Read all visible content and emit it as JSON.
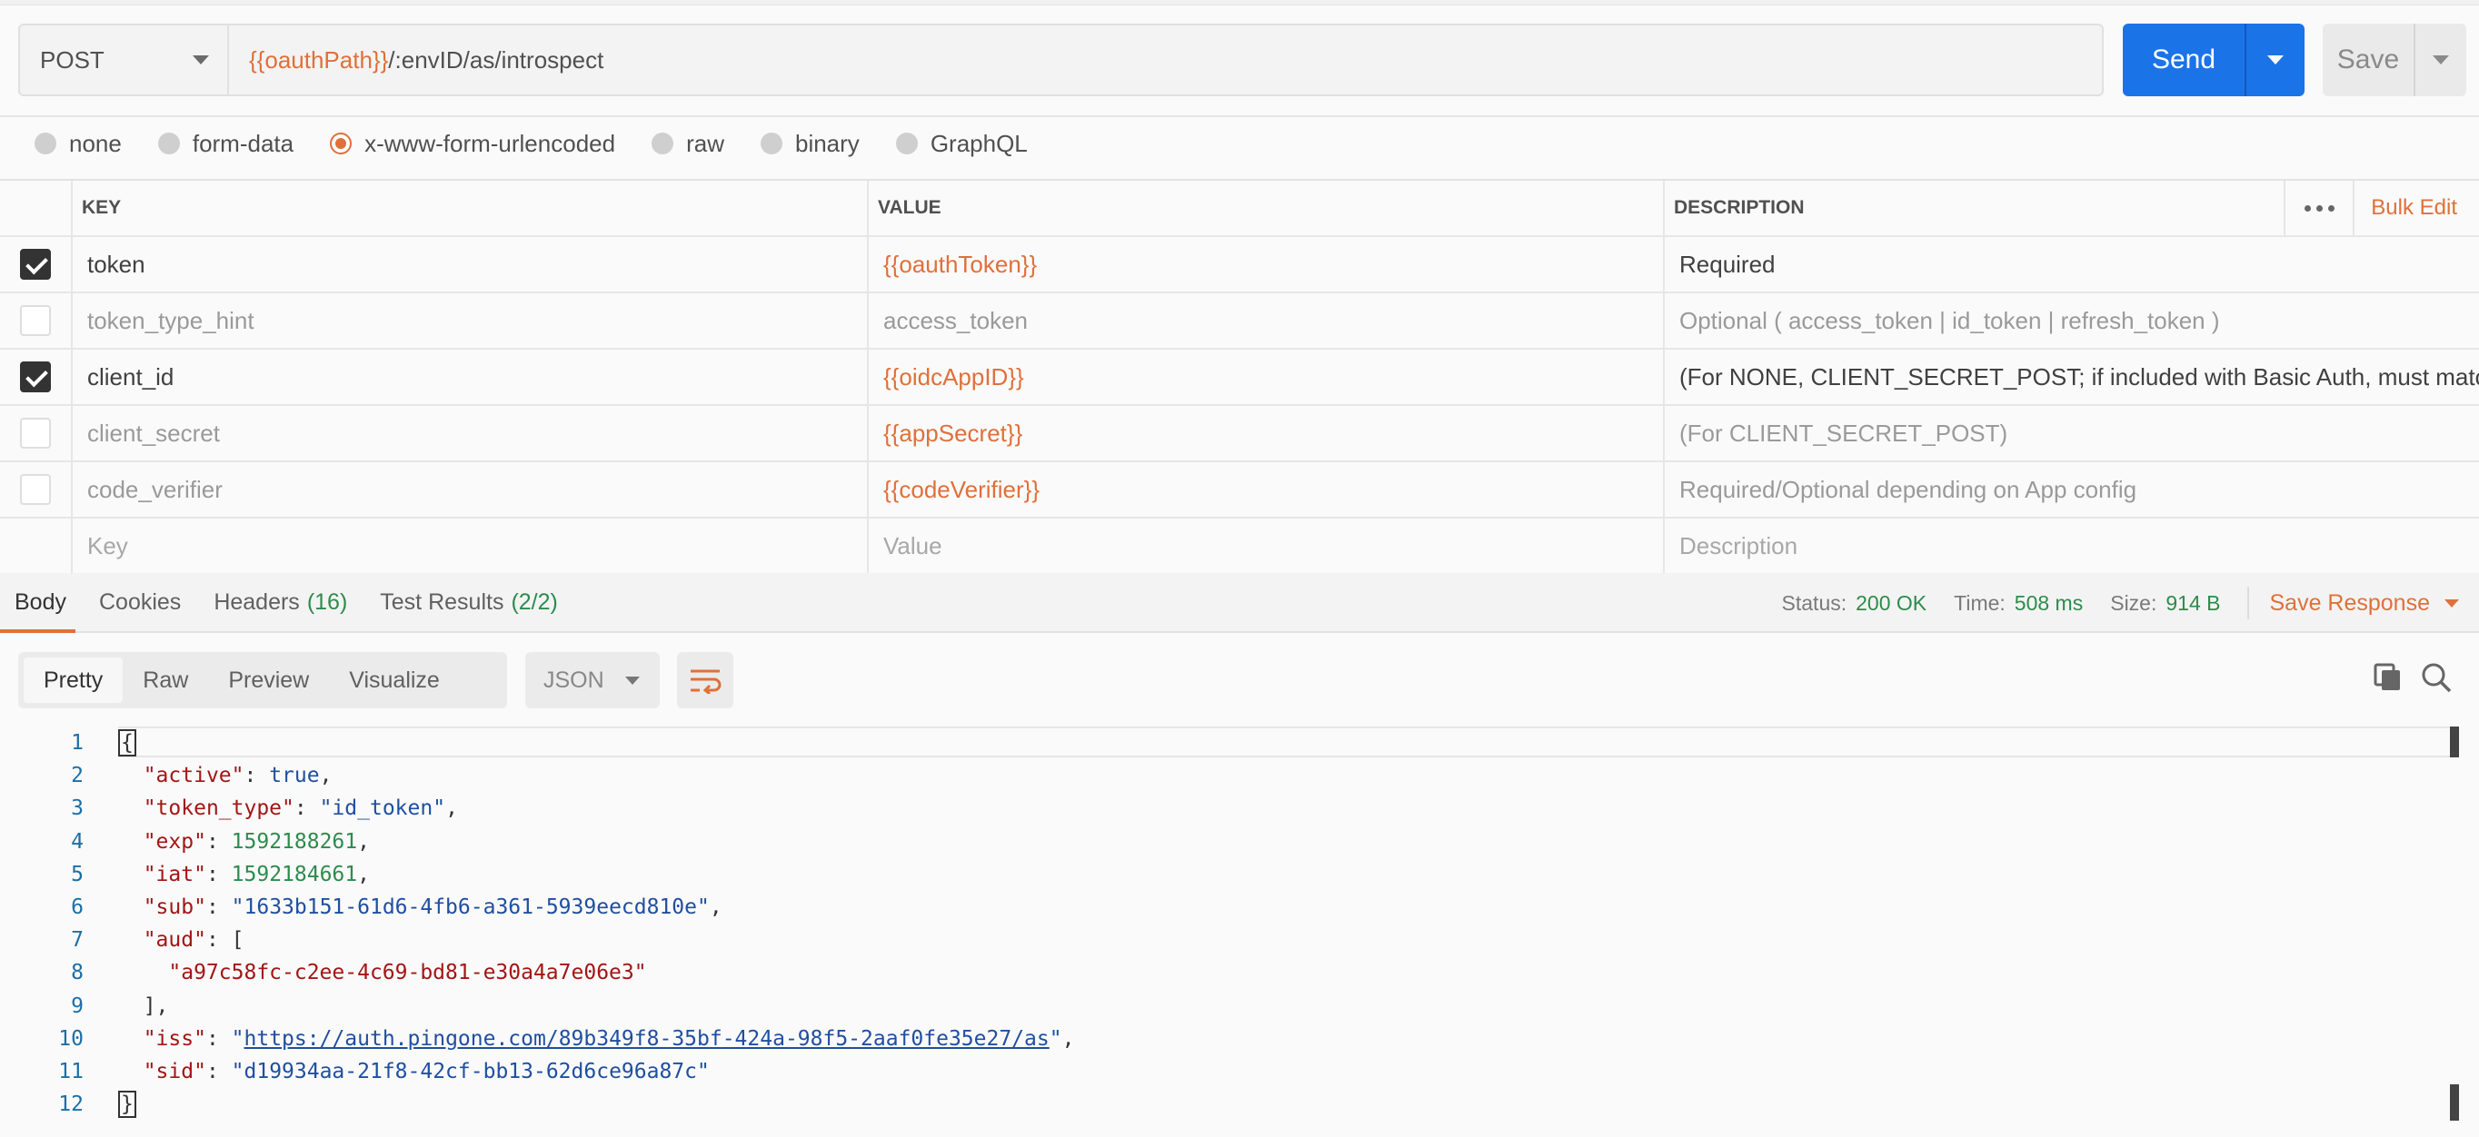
{
  "request": {
    "method": "POST",
    "url_variable": "{{oauthPath}}",
    "url_path": "/:envID/as/introspect",
    "send_label": "Send",
    "save_label": "Save"
  },
  "body_types": [
    {
      "label": "none",
      "selected": false
    },
    {
      "label": "form-data",
      "selected": false
    },
    {
      "label": "x-www-form-urlencoded",
      "selected": true
    },
    {
      "label": "raw",
      "selected": false
    },
    {
      "label": "binary",
      "selected": false
    },
    {
      "label": "GraphQL",
      "selected": false
    }
  ],
  "params": {
    "headers": {
      "key": "KEY",
      "value": "VALUE",
      "description": "DESCRIPTION",
      "bulk_edit": "Bulk Edit"
    },
    "rows": [
      {
        "checked": true,
        "key": "token",
        "value": "{{oauthToken}}",
        "description": "Required"
      },
      {
        "checked": false,
        "key": "token_type_hint",
        "value": "access_token",
        "description": "Optional ( access_token | id_token | refresh_token )"
      },
      {
        "checked": true,
        "key": "client_id",
        "value": "{{oidcAppID}}",
        "description": "(For NONE, CLIENT_SECRET_POST; if included with Basic Auth, must match H ..."
      },
      {
        "checked": false,
        "key": "client_secret",
        "value": "{{appSecret}}",
        "description": "(For CLIENT_SECRET_POST)"
      },
      {
        "checked": false,
        "key": "code_verifier",
        "value": "{{codeVerifier}}",
        "description": "Required/Optional depending on App config"
      }
    ],
    "placeholder": {
      "key": "Key",
      "value": "Value",
      "description": "Description"
    }
  },
  "response": {
    "tabs": [
      {
        "label": "Body",
        "count": ""
      },
      {
        "label": "Cookies",
        "count": ""
      },
      {
        "label": "Headers",
        "count": "(16)"
      },
      {
        "label": "Test Results",
        "count": "(2/2)"
      }
    ],
    "status_label": "Status:",
    "status_value": "200 OK",
    "time_label": "Time:",
    "time_value": "508 ms",
    "size_label": "Size:",
    "size_value": "914 B",
    "save_response": "Save Response",
    "view_tabs": [
      "Pretty",
      "Raw",
      "Preview",
      "Visualize"
    ],
    "format": "JSON"
  },
  "code": {
    "line_numbers": [
      "1",
      "2",
      "3",
      "4",
      "5",
      "6",
      "7",
      "8",
      "9",
      "10",
      "11",
      "12"
    ],
    "active": "true",
    "token_type": "\"id_token\"",
    "exp": "1592188261",
    "iat": "1592184661",
    "sub": "\"1633b151-61d6-4fb6-a361-5939eecd810e\"",
    "aud_item": "\"a97c58fc-c2ee-4c69-bd81-e30a4a7e06e3\"",
    "iss": "https://auth.pingone.com/89b349f8-35bf-424a-98f5-2aaf0fe35e27/as",
    "sid": "\"d19934aa-21f8-42cf-bb13-62d6ce96a87c\""
  },
  "colors": {
    "accent": "#e0703a",
    "send": "#1b73e8",
    "status_ok": "#2e8b4d"
  }
}
